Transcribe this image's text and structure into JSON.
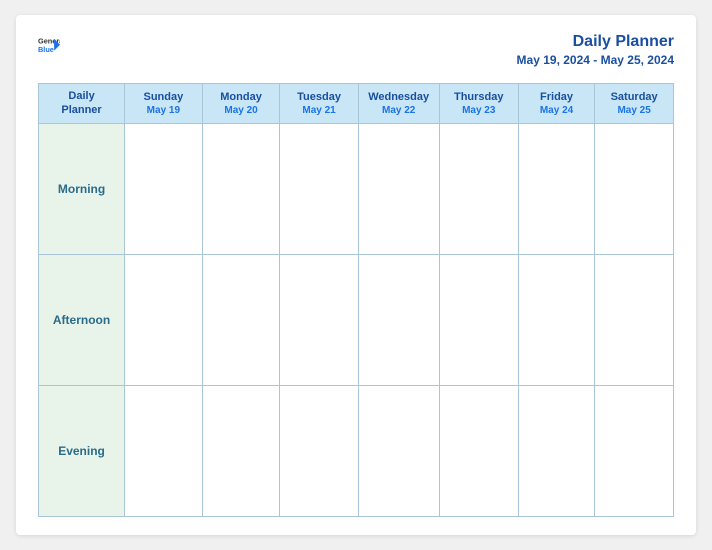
{
  "logo": {
    "text_general": "General",
    "text_blue": "Blue",
    "icon_label": "general-blue-logo"
  },
  "header": {
    "title": "Daily Planner",
    "date_range": "May 19, 2024 - May 25, 2024"
  },
  "columns": [
    {
      "day": "Daily\nPlanner",
      "date": ""
    },
    {
      "day": "Sunday",
      "date": "May 19"
    },
    {
      "day": "Monday",
      "date": "May 20"
    },
    {
      "day": "Tuesday",
      "date": "May 21"
    },
    {
      "day": "Wednesday",
      "date": "May 22"
    },
    {
      "day": "Thursday",
      "date": "May 23"
    },
    {
      "day": "Friday",
      "date": "May 24"
    },
    {
      "day": "Saturday",
      "date": "May 25"
    }
  ],
  "rows": [
    {
      "label": "Morning"
    },
    {
      "label": "Afternoon"
    },
    {
      "label": "Evening"
    }
  ]
}
